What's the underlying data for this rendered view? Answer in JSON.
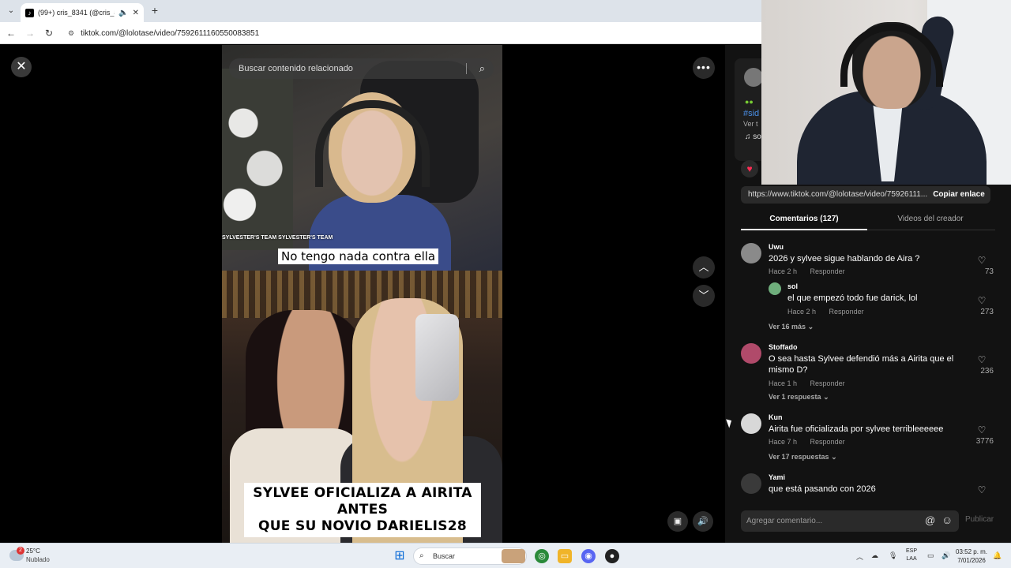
{
  "browser": {
    "tab_title": "(99+) cris_8341 (@cris_8341",
    "new_tab_label": "+",
    "url": "tiktok.com/@lolotase/video/7592611160550083851"
  },
  "video": {
    "search_placeholder": "Buscar contenido relacionado",
    "overlay_text": "SYLVESTER'S TEAM SYLVESTER'S TEAM",
    "caption_mid": "No tengo nada contra ella",
    "caption_bottom_line1": "SYLVEE OFICIALIZA A AIRITA ANTES",
    "caption_bottom_line2": "QUE SU NOVIO DARIELIS28"
  },
  "creator": {
    "hashtag": "#sid",
    "ver_text": "Ver t",
    "music_text": "♫ so"
  },
  "share": {
    "link": "https://www.tiktok.com/@lolotase/video/75926111...",
    "copy_label": "Copiar enlace"
  },
  "tabs": {
    "comments": "Comentarios (127)",
    "videos": "Videos del creador"
  },
  "comments": [
    {
      "user": "Uwu",
      "text": "2026 y sylvee sigue hablando de Aira ?",
      "time": "Hace 2 h",
      "reply": "Responder",
      "likes": "73",
      "more": "Ver 16 más"
    },
    {
      "user": "sol",
      "text": "el que empezó todo fue darick, lol",
      "time": "Hace 2 h",
      "reply": "Responder",
      "likes": "273"
    },
    {
      "user": "Stoffado",
      "text": "O sea hasta Sylvee defendió más a Airita que el mismo D?",
      "time": "Hace 1 h",
      "reply": "Responder",
      "likes": "236",
      "more": "Ver 1 respuesta"
    },
    {
      "user": "Kun",
      "text": "Airita fue oficializada por sylvee terribleeeeee",
      "time": "Hace 7 h",
      "reply": "Responder",
      "likes": "3776",
      "more": "Ver 17 respuestas"
    },
    {
      "user": "Yami",
      "text": "que está pasando con 2026",
      "time": "",
      "reply": "",
      "likes": ""
    }
  ],
  "composer": {
    "placeholder": "Agregar comentario...",
    "publish": "Publicar"
  },
  "taskbar": {
    "temp": "25°C",
    "weather": "Nublado",
    "weather_badge": "2",
    "search": "Buscar",
    "lang1": "ESP",
    "lang2": "LAA",
    "time": "03:52 p. m.",
    "date": "7/01/2026"
  },
  "colors": {
    "accent_link": "#4a8fe6",
    "heart": "#ff2d55"
  }
}
